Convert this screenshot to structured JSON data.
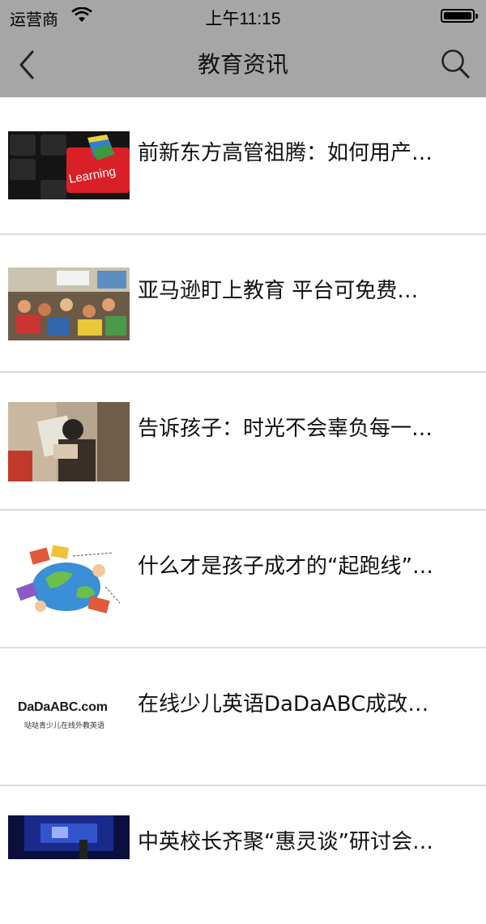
{
  "status_bar": {
    "carrier": "运营商",
    "time": "上午11:15"
  },
  "nav": {
    "title": "教育资讯",
    "back_icon": "chevron-left-icon",
    "search_icon": "search-icon"
  },
  "articles": [
    {
      "title": "前新东方高管祖腾：如何用产…",
      "thumb_text": "Learning"
    },
    {
      "title": "亚马逊盯上教育 平台可免费…"
    },
    {
      "title": "告诉孩子：时光不会辜负每一…"
    },
    {
      "title": "什么才是孩子成才的“起跑线”…"
    },
    {
      "title": "在线少儿英语DaDaABC成改…",
      "thumb_text": "DaDaABC.com",
      "thumb_subtext": "哒哒青少儿在线外教英语"
    },
    {
      "title": "中英校长齐聚“惠灵谈”研讨会…"
    }
  ]
}
